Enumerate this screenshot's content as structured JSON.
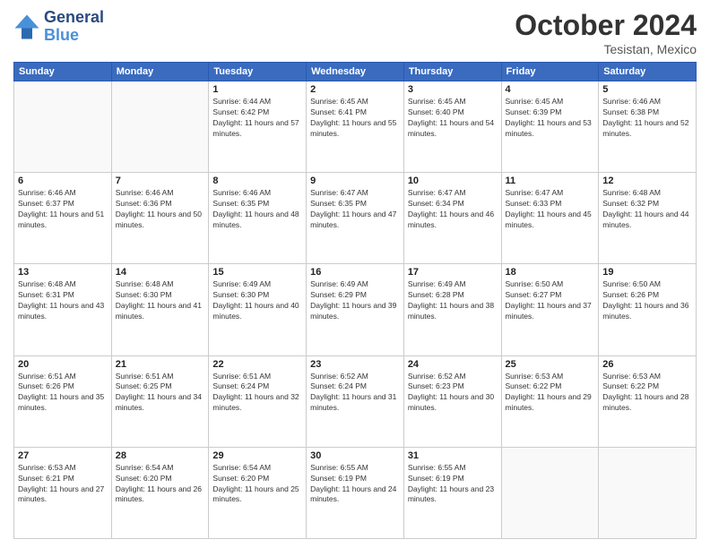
{
  "header": {
    "logo_line1": "General",
    "logo_line2": "Blue",
    "month": "October 2024",
    "location": "Tesistan, Mexico"
  },
  "weekdays": [
    "Sunday",
    "Monday",
    "Tuesday",
    "Wednesday",
    "Thursday",
    "Friday",
    "Saturday"
  ],
  "weeks": [
    [
      {
        "day": "",
        "empty": true
      },
      {
        "day": "",
        "empty": true
      },
      {
        "day": "1",
        "sunrise": "6:44 AM",
        "sunset": "6:42 PM",
        "daylight": "11 hours and 57 minutes."
      },
      {
        "day": "2",
        "sunrise": "6:45 AM",
        "sunset": "6:41 PM",
        "daylight": "11 hours and 55 minutes."
      },
      {
        "day": "3",
        "sunrise": "6:45 AM",
        "sunset": "6:40 PM",
        "daylight": "11 hours and 54 minutes."
      },
      {
        "day": "4",
        "sunrise": "6:45 AM",
        "sunset": "6:39 PM",
        "daylight": "11 hours and 53 minutes."
      },
      {
        "day": "5",
        "sunrise": "6:46 AM",
        "sunset": "6:38 PM",
        "daylight": "11 hours and 52 minutes."
      }
    ],
    [
      {
        "day": "6",
        "sunrise": "6:46 AM",
        "sunset": "6:37 PM",
        "daylight": "11 hours and 51 minutes."
      },
      {
        "day": "7",
        "sunrise": "6:46 AM",
        "sunset": "6:36 PM",
        "daylight": "11 hours and 50 minutes."
      },
      {
        "day": "8",
        "sunrise": "6:46 AM",
        "sunset": "6:35 PM",
        "daylight": "11 hours and 48 minutes."
      },
      {
        "day": "9",
        "sunrise": "6:47 AM",
        "sunset": "6:35 PM",
        "daylight": "11 hours and 47 minutes."
      },
      {
        "day": "10",
        "sunrise": "6:47 AM",
        "sunset": "6:34 PM",
        "daylight": "11 hours and 46 minutes."
      },
      {
        "day": "11",
        "sunrise": "6:47 AM",
        "sunset": "6:33 PM",
        "daylight": "11 hours and 45 minutes."
      },
      {
        "day": "12",
        "sunrise": "6:48 AM",
        "sunset": "6:32 PM",
        "daylight": "11 hours and 44 minutes."
      }
    ],
    [
      {
        "day": "13",
        "sunrise": "6:48 AM",
        "sunset": "6:31 PM",
        "daylight": "11 hours and 43 minutes."
      },
      {
        "day": "14",
        "sunrise": "6:48 AM",
        "sunset": "6:30 PM",
        "daylight": "11 hours and 41 minutes."
      },
      {
        "day": "15",
        "sunrise": "6:49 AM",
        "sunset": "6:30 PM",
        "daylight": "11 hours and 40 minutes."
      },
      {
        "day": "16",
        "sunrise": "6:49 AM",
        "sunset": "6:29 PM",
        "daylight": "11 hours and 39 minutes."
      },
      {
        "day": "17",
        "sunrise": "6:49 AM",
        "sunset": "6:28 PM",
        "daylight": "11 hours and 38 minutes."
      },
      {
        "day": "18",
        "sunrise": "6:50 AM",
        "sunset": "6:27 PM",
        "daylight": "11 hours and 37 minutes."
      },
      {
        "day": "19",
        "sunrise": "6:50 AM",
        "sunset": "6:26 PM",
        "daylight": "11 hours and 36 minutes."
      }
    ],
    [
      {
        "day": "20",
        "sunrise": "6:51 AM",
        "sunset": "6:26 PM",
        "daylight": "11 hours and 35 minutes."
      },
      {
        "day": "21",
        "sunrise": "6:51 AM",
        "sunset": "6:25 PM",
        "daylight": "11 hours and 34 minutes."
      },
      {
        "day": "22",
        "sunrise": "6:51 AM",
        "sunset": "6:24 PM",
        "daylight": "11 hours and 32 minutes."
      },
      {
        "day": "23",
        "sunrise": "6:52 AM",
        "sunset": "6:24 PM",
        "daylight": "11 hours and 31 minutes."
      },
      {
        "day": "24",
        "sunrise": "6:52 AM",
        "sunset": "6:23 PM",
        "daylight": "11 hours and 30 minutes."
      },
      {
        "day": "25",
        "sunrise": "6:53 AM",
        "sunset": "6:22 PM",
        "daylight": "11 hours and 29 minutes."
      },
      {
        "day": "26",
        "sunrise": "6:53 AM",
        "sunset": "6:22 PM",
        "daylight": "11 hours and 28 minutes."
      }
    ],
    [
      {
        "day": "27",
        "sunrise": "6:53 AM",
        "sunset": "6:21 PM",
        "daylight": "11 hours and 27 minutes."
      },
      {
        "day": "28",
        "sunrise": "6:54 AM",
        "sunset": "6:20 PM",
        "daylight": "11 hours and 26 minutes."
      },
      {
        "day": "29",
        "sunrise": "6:54 AM",
        "sunset": "6:20 PM",
        "daylight": "11 hours and 25 minutes."
      },
      {
        "day": "30",
        "sunrise": "6:55 AM",
        "sunset": "6:19 PM",
        "daylight": "11 hours and 24 minutes."
      },
      {
        "day": "31",
        "sunrise": "6:55 AM",
        "sunset": "6:19 PM",
        "daylight": "11 hours and 23 minutes."
      },
      {
        "day": "",
        "empty": true
      },
      {
        "day": "",
        "empty": true
      }
    ]
  ]
}
